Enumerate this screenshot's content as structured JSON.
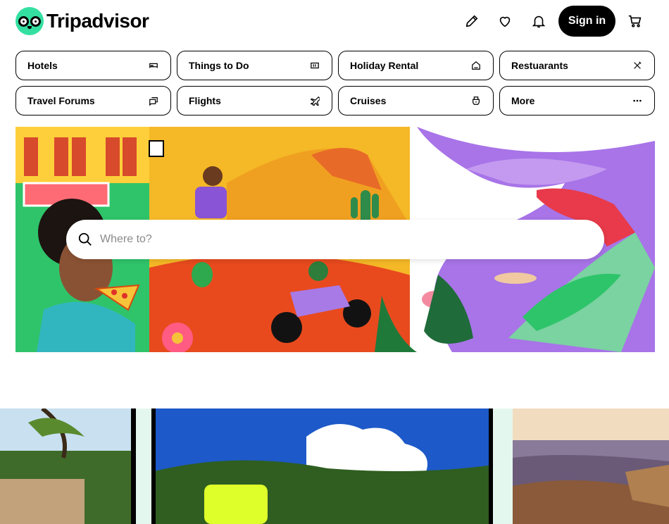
{
  "header": {
    "brand": "Tripadvisor",
    "signin_label": "Sign in",
    "icons": [
      "pencil-icon",
      "heart-icon",
      "bell-icon",
      "cart-icon"
    ]
  },
  "categories": [
    {
      "label": "Hotels",
      "icon": "bed-icon"
    },
    {
      "label": "Things to Do",
      "icon": "ticket-icon"
    },
    {
      "label": "Holiday Rental",
      "icon": "house-icon"
    },
    {
      "label": "Restuarants",
      "icon": "cutlery-icon"
    },
    {
      "label": "Travel Forums",
      "icon": "chat-icon"
    },
    {
      "label": "Flights",
      "icon": "plane-icon"
    },
    {
      "label": "Cruises",
      "icon": "ship-icon"
    },
    {
      "label": "More",
      "icon": "more-dots-icon"
    }
  ],
  "search": {
    "placeholder": "Where to?"
  },
  "colors": {
    "brand_green": "#34E0A1",
    "black": "#000000",
    "hero_orange": "#F5B826",
    "hero_purple": "#A874E8",
    "hero_green": "#3CC96B"
  }
}
